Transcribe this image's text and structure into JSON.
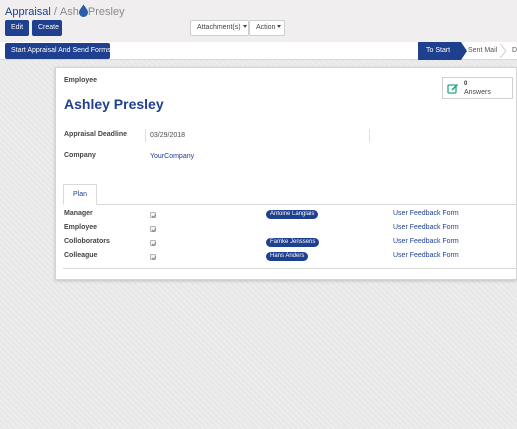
{
  "breadcrumb": {
    "parent": "Appraisal",
    "separator": "/",
    "current_part1": "Ash",
    "current_part2": "Presley"
  },
  "toolbar": {
    "edit_label": "Edit",
    "create_label": "Create",
    "attachments_label": "Attachment(s)",
    "action_label": "Action"
  },
  "statusbar": {
    "button_label": "Start Appraisal And Send Forms",
    "stages": [
      "To Start",
      "Sent Mail",
      "D"
    ],
    "active_stage": "To Start"
  },
  "form": {
    "employee_label": "Employee",
    "employee_name": "Ashley Presley",
    "smart_button": {
      "count": "0",
      "label": "Answers"
    },
    "deadline_label": "Appraisal Deadline",
    "deadline_value": "03/29/2018",
    "company_label": "Company",
    "company_value": "YourCompany",
    "tab_label": "Plan",
    "plan_rows": [
      {
        "label": "Manager",
        "checked": true,
        "tag": "Antoine Langlais",
        "form": "User Feedback Form"
      },
      {
        "label": "Employee",
        "checked": true,
        "tag": "",
        "form": "User Feedback Form"
      },
      {
        "label": "Colloborators",
        "checked": true,
        "tag": "Famke Jenssens",
        "form": "User Feedback Form"
      },
      {
        "label": "Colleague",
        "checked": true,
        "tag": "Hans Anders",
        "form": "User Feedback Form"
      }
    ]
  },
  "colors": {
    "primary": "#1f3f8f",
    "link": "#1f3f95",
    "smart_icon": "#2ea58a"
  },
  "icons": {
    "drop": "drop-icon",
    "smart": "pencil-square-icon",
    "check": "check-icon"
  }
}
